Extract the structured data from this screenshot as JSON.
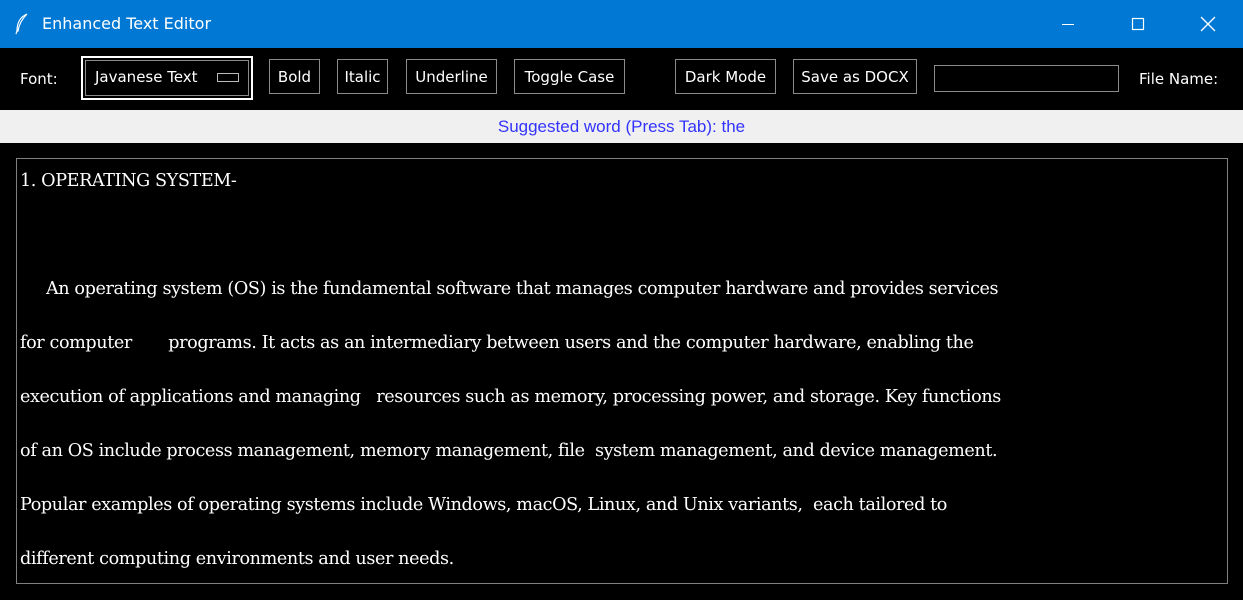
{
  "window": {
    "title": "Enhanced Text Editor"
  },
  "toolbar": {
    "font_label": "Font:",
    "font_value": "Javanese Text",
    "bold": "Bold",
    "italic": "Italic",
    "underline": "Underline",
    "toggle_case": "Toggle Case",
    "dark_mode": "Dark Mode",
    "save_docx": "Save as DOCX",
    "file_name_value": "",
    "file_name_label": "File Name:"
  },
  "suggestion": "Suggested word (Press Tab): the",
  "editor": {
    "lines": [
      "1. OPERATING SYSTEM-",
      "",
      "     An operating system (OS) is the fundamental software that manages computer hardware and provides services",
      "for computer       programs. It acts as an intermediary between users and the computer hardware, enabling the",
      "execution of applications and managing   resources such as memory, processing power, and storage. Key functions",
      "of an OS include process management, memory management, file  system management, and device management.",
      "Popular examples of operating systems include Windows, macOS, Linux, and Unix variants,  each tailored to",
      "different computing environments and user needs."
    ]
  },
  "colors": {
    "titlebar": "#0078d4",
    "suggestion_text": "#3333ff",
    "editor_bg": "#000000",
    "editor_text": "#ffffff"
  },
  "icons": {
    "app": "feather-icon",
    "minimize": "minimize-icon",
    "maximize": "maximize-icon",
    "close": "close-icon"
  }
}
